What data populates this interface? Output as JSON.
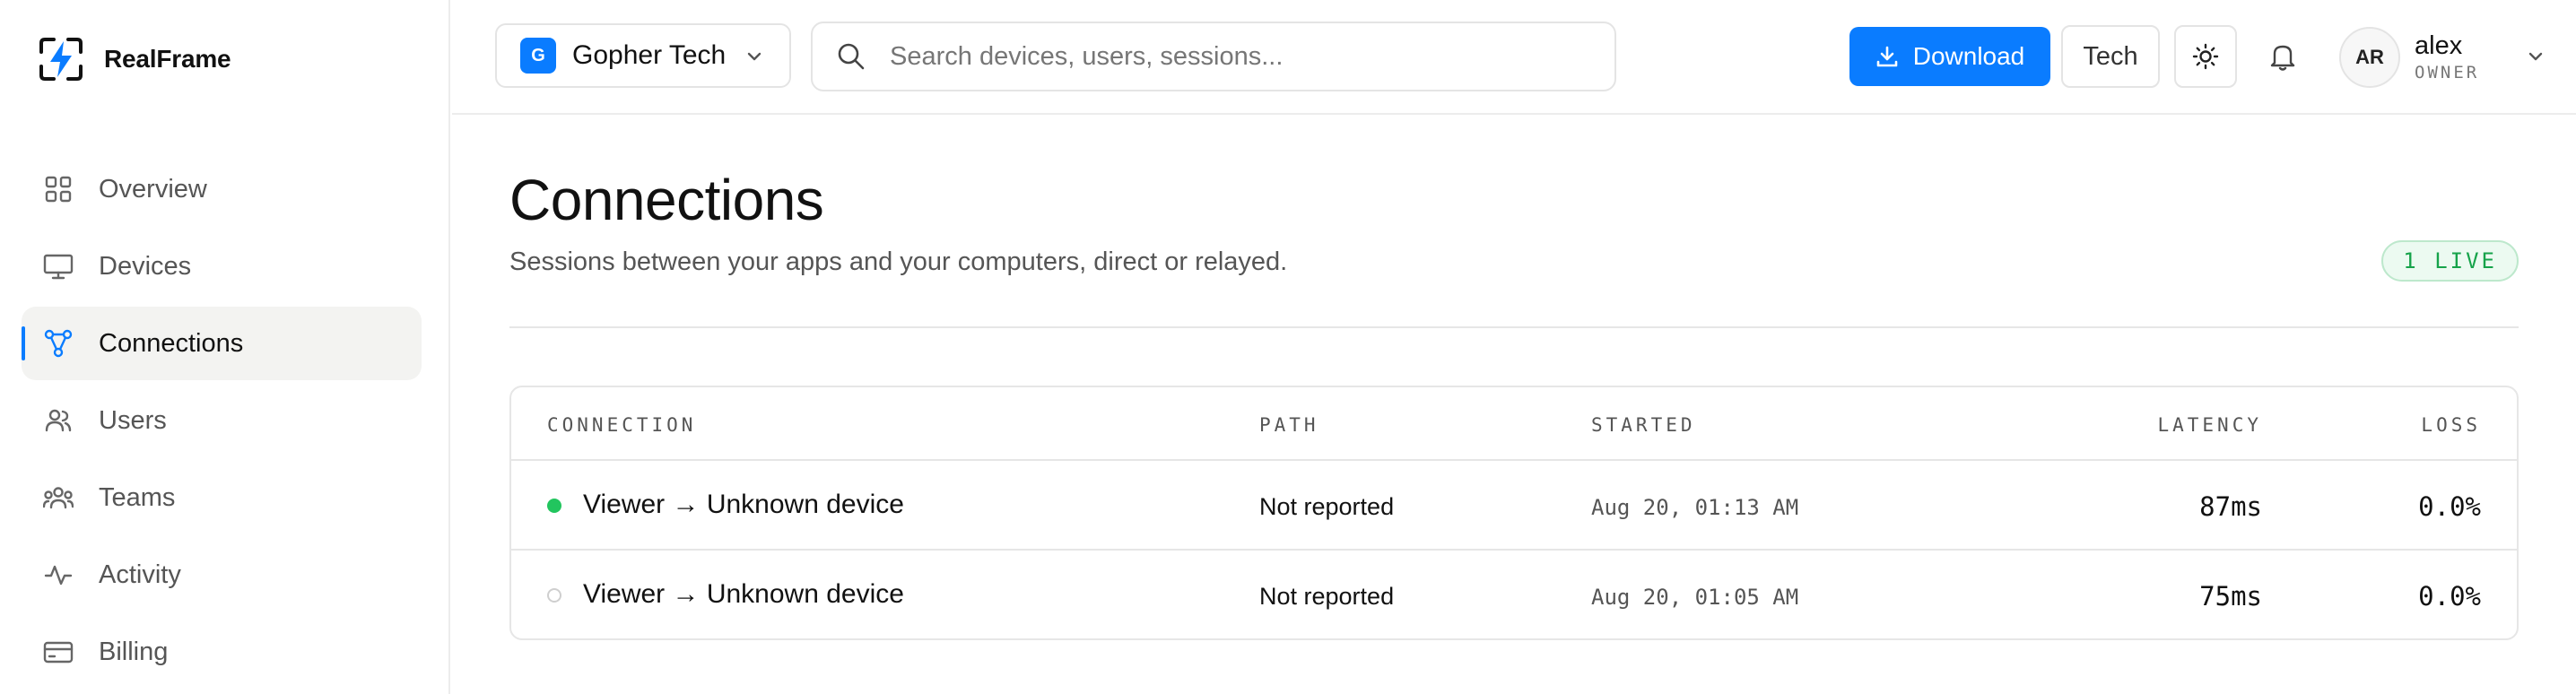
{
  "brand": {
    "name": "RealFrame"
  },
  "sidebar": {
    "items": [
      {
        "label": "Overview",
        "icon": "grid-icon"
      },
      {
        "label": "Devices",
        "icon": "monitor-icon"
      },
      {
        "label": "Connections",
        "icon": "network-icon",
        "active": true
      },
      {
        "label": "Users",
        "icon": "users-icon"
      },
      {
        "label": "Teams",
        "icon": "team-icon"
      },
      {
        "label": "Activity",
        "icon": "activity-icon"
      },
      {
        "label": "Billing",
        "icon": "credit-card-icon"
      }
    ]
  },
  "header": {
    "org_initial": "G",
    "org_name": "Gopher Tech",
    "search_placeholder": "Search devices, users, sessions...",
    "download_label": "Download",
    "tech_label": "Tech",
    "user": {
      "initials": "AR",
      "name": "alex",
      "role": "OWNER"
    }
  },
  "page": {
    "title": "Connections",
    "subtitle": "Sessions between your apps and your computers, direct or relayed.",
    "live_badge": "1 LIVE"
  },
  "table": {
    "columns": {
      "connection": "CONNECTION",
      "path": "PATH",
      "started": "STARTED",
      "latency": "LATENCY",
      "loss": "LOSS"
    },
    "rows": [
      {
        "live": true,
        "connection": "Viewer → Unknown device",
        "path": "Not reported",
        "started": "Aug 20, 01:13 AM",
        "latency": "87ms",
        "loss": "0.0%"
      },
      {
        "live": false,
        "connection": "Viewer → Unknown device",
        "path": "Not reported",
        "started": "Aug 20, 01:05 AM",
        "latency": "75ms",
        "loss": "0.0%"
      }
    ]
  },
  "colors": {
    "accent": "#0a7cff",
    "live": "#22c55e",
    "border": "#e6e6e6"
  }
}
